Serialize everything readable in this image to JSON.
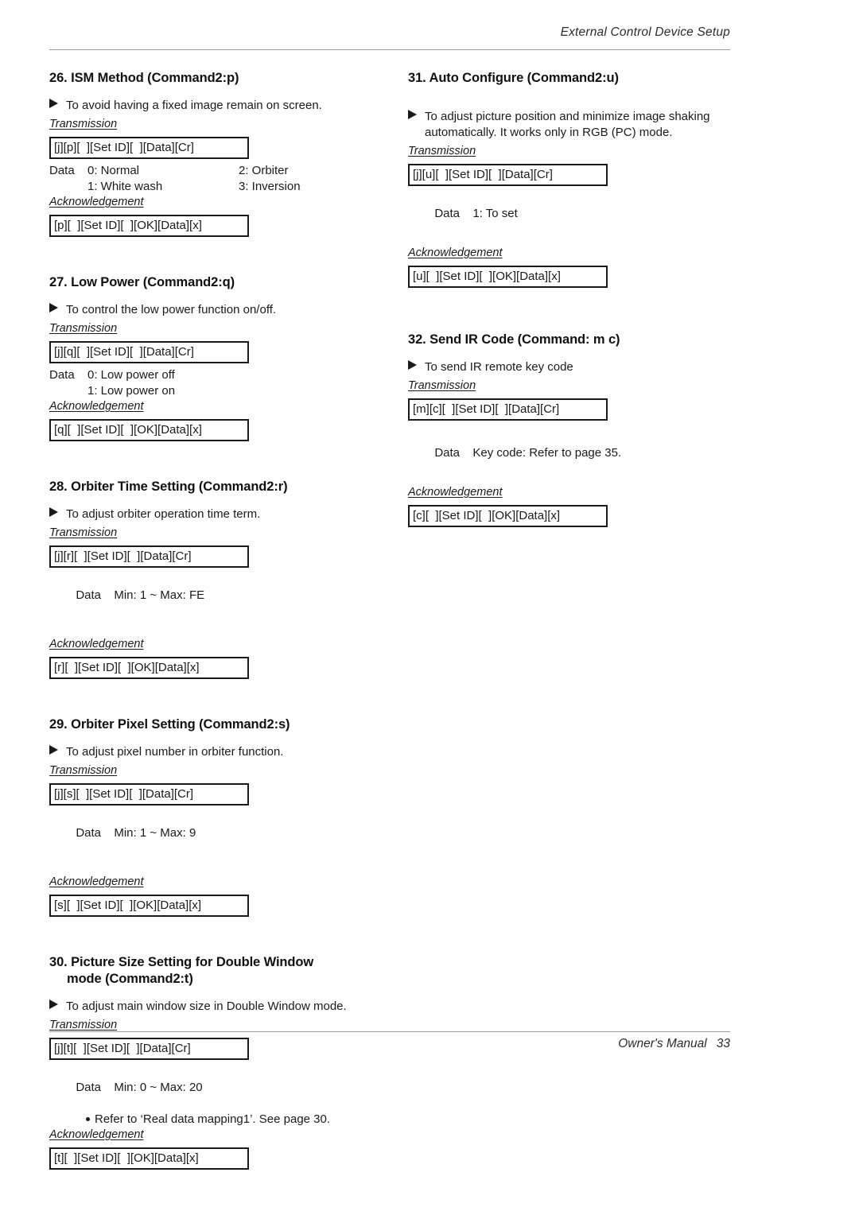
{
  "header": {
    "title": "External Control Device Setup"
  },
  "footer": {
    "label": "Owner's Manual",
    "page": "33"
  },
  "labels": {
    "transmission": "Transmission",
    "acknowledgement": "Acknowledgement",
    "data": "Data"
  },
  "left_column": [
    {
      "number": "26.",
      "title": "26. ISM Method (Command2:p)",
      "description": "To avoid having a fixed image remain on screen.",
      "transmission_label": "Transmission",
      "transmission_code": "[j][p][  ][Set ID][  ][Data][Cr]",
      "data_label": "Data",
      "data_rows_col1": [
        "0: Normal",
        "1: White wash"
      ],
      "data_rows_col2": [
        "2: Orbiter",
        "3: Inversion"
      ],
      "acknowledgement_label": "Acknowledgement",
      "acknowledgement_code": "[p][  ][Set ID][  ][OK][Data][x]"
    },
    {
      "number": "27.",
      "title": "27. Low Power (Command2:q)",
      "description": "To control the low power function on/off.",
      "transmission_label": "Transmission",
      "transmission_code": "[j][q][  ][Set ID][  ][Data][Cr]",
      "data_label": "Data",
      "data_rows_col1": [
        "0: Low power off",
        "1: Low power on"
      ],
      "acknowledgement_label": "Acknowledgement",
      "acknowledgement_code": "[q][  ][Set ID][  ][OK][Data][x]"
    },
    {
      "number": "28.",
      "title": "28. Orbiter Time Setting (Command2:r)",
      "description": "To adjust orbiter operation time term.",
      "transmission_label": "Transmission",
      "transmission_code": "[j][r][  ][Set ID][  ][Data][Cr]",
      "data_label": "Data",
      "data_value": "Min: 1 ~ Max: FE",
      "acknowledgement_label": "Acknowledgement",
      "acknowledgement_code": "[r][  ][Set ID][  ][OK][Data][x]"
    },
    {
      "number": "29.",
      "title": "29. Orbiter Pixel Setting (Command2:s)",
      "description": "To adjust pixel number in orbiter function.",
      "transmission_label": "Transmission",
      "transmission_code": "[j][s][  ][Set ID][  ][Data][Cr]",
      "data_label": "Data",
      "data_value": "Min: 1 ~ Max: 9",
      "acknowledgement_label": "Acknowledgement",
      "acknowledgement_code": "[s][  ][Set ID][  ][OK][Data][x]"
    },
    {
      "number": "30.",
      "title_line1": "30. Picture Size Setting for Double Window",
      "title_line2": "mode (Command2:t)",
      "description": "To adjust main window size in Double Window mode.",
      "transmission_label": "Transmission",
      "transmission_code": "[j][t][  ][Set ID][  ][Data][Cr]",
      "data_label": "Data",
      "data_value": "Min: 0 ~ Max: 20",
      "note": "Refer to ‘Real data mapping1’. See page 30.",
      "acknowledgement_label": "Acknowledgement",
      "acknowledgement_code": "[t][  ][Set ID][  ][OK][Data][x]"
    }
  ],
  "right_column": [
    {
      "number": "31.",
      "title": "31. Auto Configure (Command2:u)",
      "description_line1": "To adjust picture position and minimize image shaking",
      "description_line2": "automatically. It works only in RGB (PC) mode.",
      "transmission_label": "Transmission",
      "transmission_code": "[j][u][  ][Set ID][  ][Data][Cr]",
      "data_label": "Data",
      "data_value": "1: To set",
      "acknowledgement_label": "Acknowledgement",
      "acknowledgement_code": "[u][  ][Set ID][  ][OK][Data][x]"
    },
    {
      "number": "32.",
      "title": "32. Send IR Code (Command: m c)",
      "description": "To send IR remote key code",
      "transmission_label": "Transmission",
      "transmission_code": "[m][c][  ][Set ID][  ][Data][Cr]",
      "data_label": "Data",
      "data_value": "Key code: Refer to page 35.",
      "acknowledgement_label": "Acknowledgement",
      "acknowledgement_code": "[c][  ][Set ID][  ][OK][Data][x]"
    }
  ]
}
